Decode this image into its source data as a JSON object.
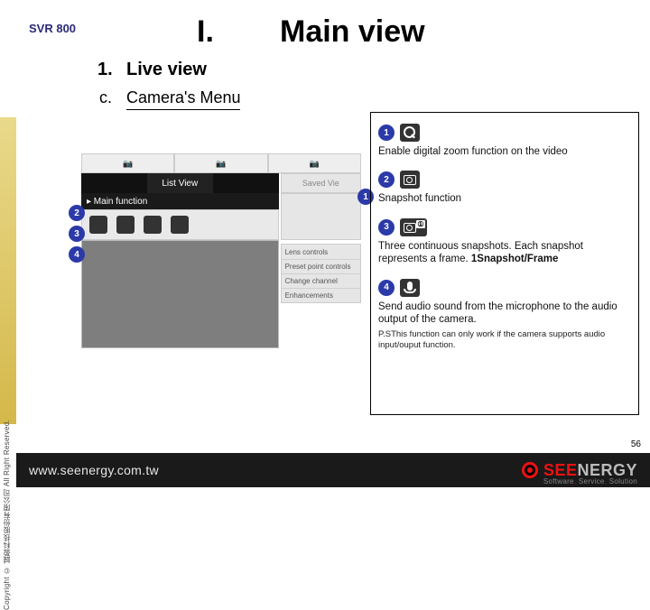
{
  "header": {
    "product": "SVR 800"
  },
  "title": {
    "num": "I.",
    "text": "Main view"
  },
  "section": {
    "num": "1.",
    "text": "Live view"
  },
  "subsection": {
    "num": "c.",
    "text": "Camera's Menu"
  },
  "sidebar_text": "Copyright © 誠盈科技股份有限公司 All Right Reserved.",
  "mock": {
    "tabs": [
      "",
      "List View",
      ""
    ],
    "saved": "Saved Vie",
    "main_function": "▸ Main function",
    "panel_rows": [
      "Lens controls",
      "Preset point controls",
      "Change channel",
      "Enhancements"
    ]
  },
  "left_bubbles": {
    "b2": "2",
    "b3": "3",
    "b4": "4"
  },
  "right": {
    "items": [
      {
        "num": "1",
        "text": "Enable digital zoom function on the video"
      },
      {
        "num": "2",
        "text": "Snapshot function"
      },
      {
        "num": "3",
        "text": "Three continuous snapshots. Each snapshot represents a frame. ",
        "bold": "1Snapshot/Frame",
        "badge": "①"
      },
      {
        "num": "4",
        "text": "Send audio sound from the microphone to the audio output of the camera.",
        "ps": "P.SThis function can only work if the camera supports audio input/ouput function."
      }
    ]
  },
  "footer": {
    "url": "www.seenergy.com.tw",
    "brand_left": "SEE",
    "brand_right": "NERGY",
    "tagline_parts": [
      "Software",
      "Service",
      "Solution"
    ]
  },
  "page_number": "56"
}
